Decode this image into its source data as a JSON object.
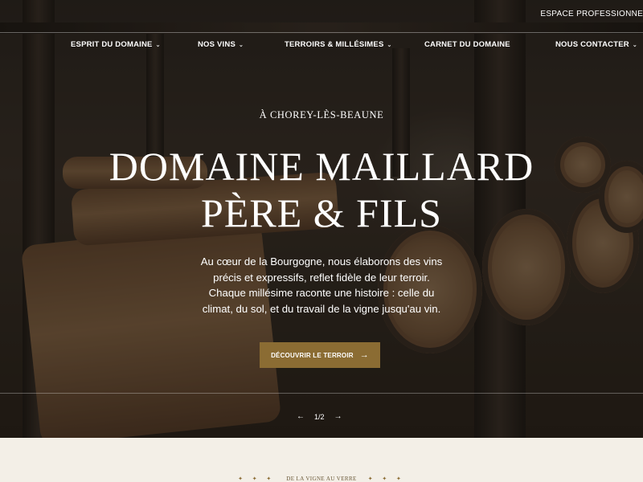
{
  "header": {
    "espace_label": "ESPACE PROFESSIONNEL",
    "nav": [
      {
        "label": "ESPRIT DU DOMAINE",
        "dropdown": true
      },
      {
        "label": "NOS VINS",
        "dropdown": true
      },
      {
        "label": "TERROIRS & MILLÉSIMES",
        "dropdown": true
      },
      {
        "label": "CARNET DU DOMAINE",
        "dropdown": false
      },
      {
        "label": "NOUS CONTACTER",
        "dropdown": true
      }
    ]
  },
  "hero": {
    "kicker": "À CHOREY-LÈS-BEAUNE",
    "title_line1": "DOMAINE MAILLARD",
    "title_line2": "PÈRE & FILS",
    "lead": "Au cœur de la Bourgogne, nous élaborons des vins précis et expressifs, reflet fidèle de leur terroir. Chaque millésime raconte une histoire : celle du climat, du sol, et du travail de la vigne jusqu'au vin.",
    "cta_label": "DÉCOUVRIR LE TERROIR",
    "cta_arrow": "→",
    "pager_prev": "←",
    "pager_text": "1/2",
    "pager_next": "→"
  },
  "section": {
    "eyebrow": "DE LA VIGNE AU VERRE",
    "stars": "✦ ✦ ✦"
  },
  "colors": {
    "accent": "#8b6c33",
    "background": "#f3efe7"
  }
}
